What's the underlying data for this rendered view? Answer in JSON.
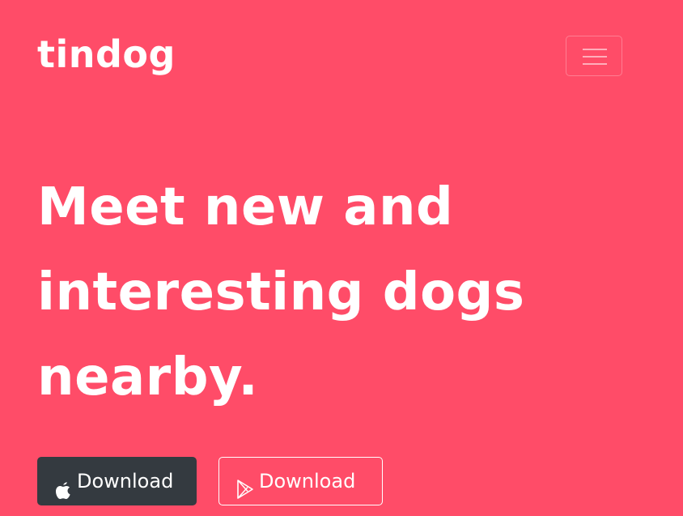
{
  "brand": {
    "name": "tindog"
  },
  "nav": {
    "toggler_icon": "hamburger-icon"
  },
  "hero": {
    "headline": "Meet new and interesting dogs nearby."
  },
  "buttons": {
    "apple": {
      "label": "Download",
      "icon": "apple-icon"
    },
    "google_play": {
      "label": "Download",
      "icon": "google-play-icon"
    }
  },
  "colors": {
    "background": "#ff4c68",
    "text": "#ffffff",
    "dark_button": "#343a40"
  }
}
